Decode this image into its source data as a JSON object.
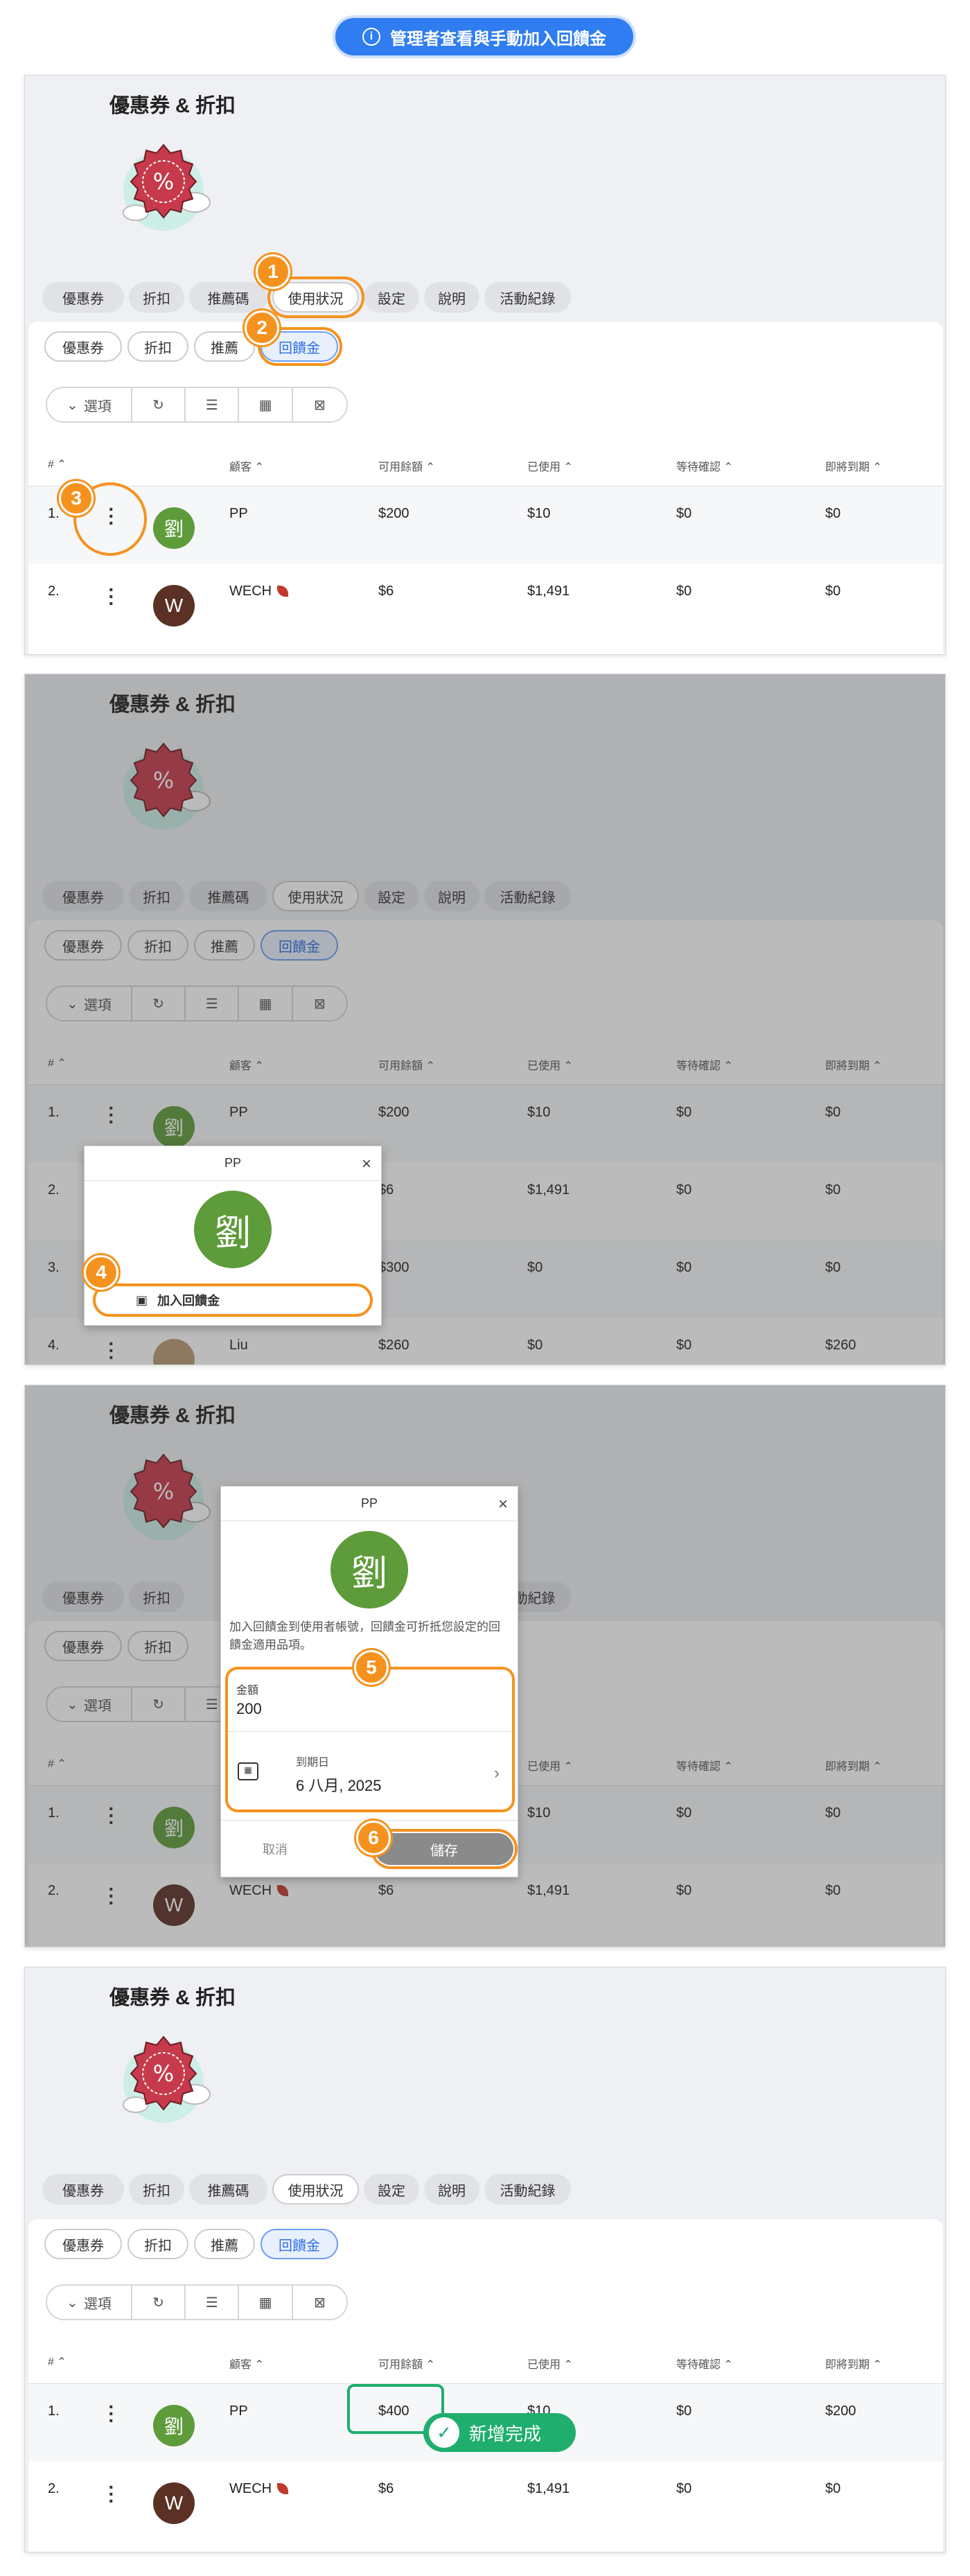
{
  "banner": {
    "icon": "info-icon",
    "text": "管理者查看與手動加入回饋金"
  },
  "page": {
    "title": "優惠券 & 折扣",
    "hero_icon": "coupon-badge-icon"
  },
  "top_tabs": [
    "優惠券",
    "折扣",
    "推薦碼",
    "使用狀況",
    "設定",
    "說明",
    "活動紀錄"
  ],
  "sub_tabs": [
    "優惠券",
    "折扣",
    "推薦",
    "回饋金"
  ],
  "toolbar": {
    "options_label": "選項",
    "icons": [
      "refresh-icon",
      "filter-sliders-icon",
      "export-csv-icon",
      "export-excel-icon"
    ]
  },
  "table": {
    "headers": [
      "# ⌃",
      "顧客 ⌃",
      "可用餘額 ⌃",
      "已使用 ⌃",
      "等待確認 ⌃",
      "即將到期 ⌃"
    ],
    "rows_step1": [
      {
        "index": "1.",
        "avatar": "劉",
        "name": "PP",
        "balance": "$200",
        "used": "$10",
        "pending": "$0",
        "expiring": "$0"
      },
      {
        "index": "2.",
        "avatar": "W",
        "name": "WECH",
        "balance": "$6",
        "used": "$1,491",
        "pending": "$0",
        "expiring": "$0"
      }
    ],
    "rows_step2": [
      {
        "index": "1.",
        "name": "PP",
        "balance": "$200",
        "used": "$10",
        "pending": "$0",
        "expiring": "$0"
      },
      {
        "index": "2.",
        "name": "",
        "balance": "$6",
        "used": "$1,491",
        "pending": "$0",
        "expiring": "$0"
      },
      {
        "index": "3.",
        "name": "",
        "balance": "$300",
        "used": "$0",
        "pending": "$0",
        "expiring": "$0"
      },
      {
        "index": "4.",
        "name": "Liu",
        "balance": "$260",
        "used": "$0",
        "pending": "$0",
        "expiring": "$260"
      }
    ],
    "rows_step4": [
      {
        "index": "1.",
        "avatar": "劉",
        "name": "PP",
        "balance": "$400",
        "used": "$10",
        "pending": "$0",
        "expiring": "$200"
      },
      {
        "index": "2.",
        "avatar": "W",
        "name": "WECH",
        "balance": "$6",
        "used": "$1,491",
        "pending": "$0",
        "expiring": "$0"
      }
    ]
  },
  "menu_popup": {
    "title": "PP",
    "avatar": "劉",
    "action": "加入回饋金"
  },
  "add_dialog": {
    "title": "PP",
    "avatar": "劉",
    "description": "加入回饋金到使用者帳號，回饋金可折抵您設定的回饋金適用品項。",
    "amount_label": "金額",
    "amount_value": "200",
    "expiry_label": "到期日",
    "expiry_value": "6 八月, 2025",
    "cancel": "取消",
    "save": "儲存"
  },
  "success_toast": "新增完成",
  "steps": [
    "1",
    "2",
    "3",
    "4",
    "5",
    "6"
  ],
  "colors": {
    "accent": "#f5921e",
    "primary": "#2f7df0",
    "success": "#1fae6d",
    "avatar_green": "#5e9b3a",
    "avatar_brown": "#5b3126"
  }
}
